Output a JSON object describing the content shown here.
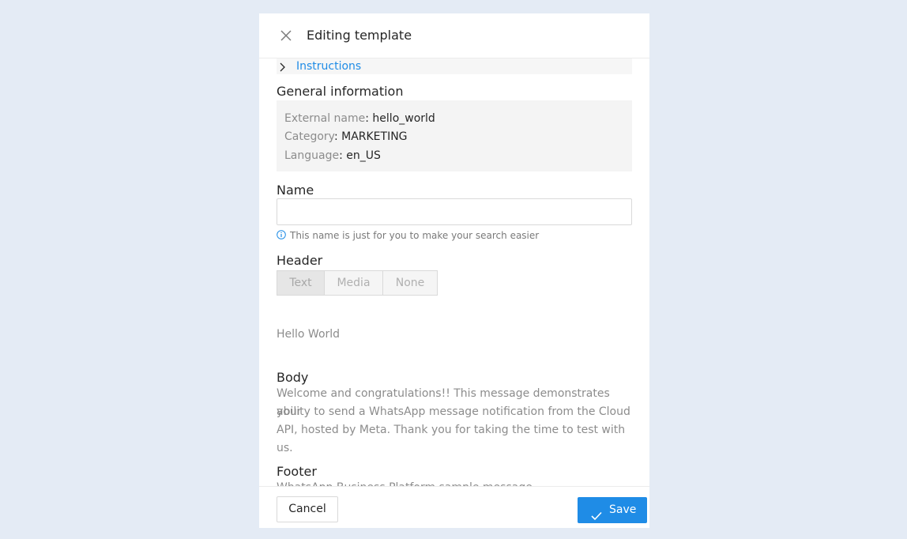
{
  "modal": {
    "title": "Editing template",
    "close_icon": "close-icon"
  },
  "instructions": {
    "label": "Instructions",
    "icon": "chevron-right-icon"
  },
  "general_info": {
    "title": "General information",
    "rows": [
      {
        "key": "External name",
        "value": "hello_world"
      },
      {
        "key": "Category",
        "value": "MARKETING"
      },
      {
        "key": "Language",
        "value": "en_US"
      }
    ]
  },
  "name": {
    "label": "Name",
    "value": "",
    "placeholder": "",
    "hint": "This name is just for you to make your search easier",
    "hint_icon": "info-icon"
  },
  "header": {
    "label": "Header",
    "options": [
      "Text",
      "Media",
      "None"
    ],
    "selected": "Text",
    "text": "Hello World"
  },
  "body": {
    "label": "Body",
    "text_lines": [
      "Welcome and congratulations!! This message demonstrates your",
      "ability to send a WhatsApp message notification from the Cloud",
      "API, hosted by Meta. Thank you for taking the time to test with us."
    ]
  },
  "footer": {
    "label": "Footer",
    "text": "WhatsApp Business Platform sample message"
  },
  "actions": {
    "cancel_label": "Cancel",
    "save_label": "Save",
    "save_icon": "check-icon"
  },
  "colors": {
    "background": "#e4ebf5",
    "accent": "#1f8ce6",
    "info_box": "#f4f4f4"
  }
}
